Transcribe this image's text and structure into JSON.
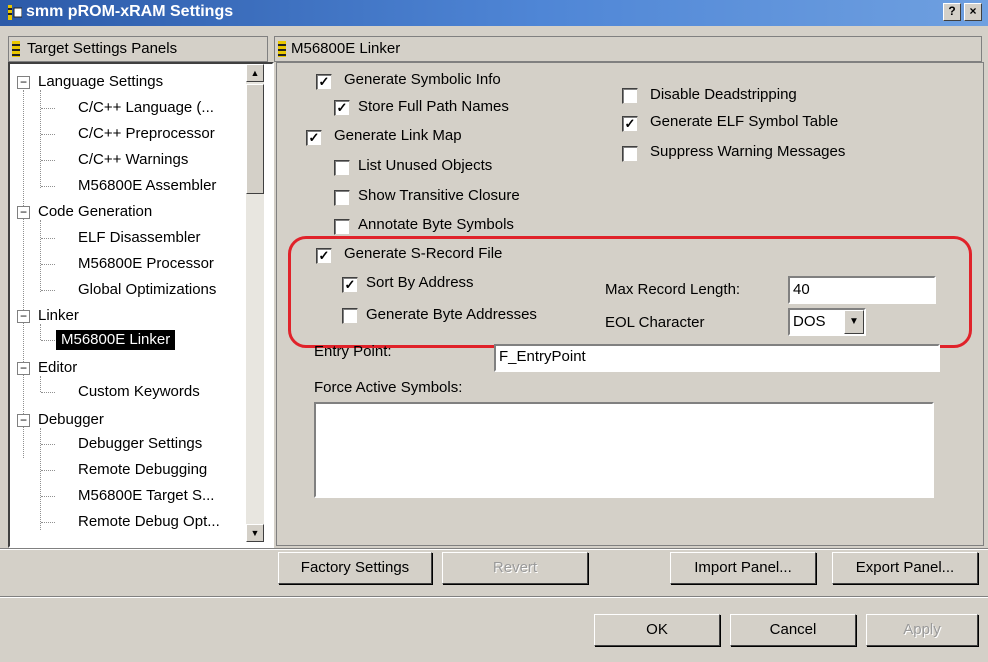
{
  "window": {
    "title": "smm pROM-xRAM Settings",
    "help_glyph": "?",
    "close_glyph": "×"
  },
  "left_panel": {
    "header": "Target Settings Panels",
    "tree": [
      {
        "label": "Language Settings",
        "level": 0,
        "expanded": true
      },
      {
        "label": "C/C++ Language (...",
        "level": 1
      },
      {
        "label": "C/C++ Preprocessor",
        "level": 1
      },
      {
        "label": "C/C++ Warnings",
        "level": 1
      },
      {
        "label": "M56800E Assembler",
        "level": 1
      },
      {
        "label": "Code Generation",
        "level": 0,
        "expanded": true
      },
      {
        "label": "ELF Disassembler",
        "level": 1
      },
      {
        "label": "M56800E Processor",
        "level": 1
      },
      {
        "label": "Global Optimizations",
        "level": 1
      },
      {
        "label": "Linker",
        "level": 0,
        "expanded": true
      },
      {
        "label": "M56800E Linker",
        "level": 1,
        "selected": true
      },
      {
        "label": "Editor",
        "level": 0,
        "expanded": true
      },
      {
        "label": "Custom Keywords",
        "level": 1
      },
      {
        "label": "Debugger",
        "level": 0,
        "expanded": true
      },
      {
        "label": "Debugger Settings",
        "level": 1
      },
      {
        "label": "Remote Debugging",
        "level": 1
      },
      {
        "label": "M56800E Target S...",
        "level": 1
      },
      {
        "label": "Remote Debug Opt...",
        "level": 1
      }
    ]
  },
  "right_panel": {
    "header": "M56800E Linker",
    "options": {
      "generate_symbolic_info": {
        "label": "Generate Symbolic Info",
        "checked": true
      },
      "store_full_path_names": {
        "label": "Store Full Path Names",
        "checked": true
      },
      "generate_link_map": {
        "label": "Generate Link Map",
        "checked": true
      },
      "list_unused_objects": {
        "label": "List Unused Objects",
        "checked": false
      },
      "show_transitive_closure": {
        "label": "Show Transitive Closure",
        "checked": false
      },
      "annotate_byte_symbols": {
        "label": "Annotate Byte Symbols",
        "checked": false
      },
      "disable_deadstripping": {
        "label": "Disable Deadstripping",
        "checked": false
      },
      "generate_elf_symbol_table": {
        "label": "Generate ELF Symbol Table",
        "checked": true
      },
      "suppress_warning_messages": {
        "label": "Suppress Warning Messages",
        "checked": false
      },
      "generate_s_record_file": {
        "label": "Generate S-Record File",
        "checked": true
      },
      "sort_by_address": {
        "label": "Sort By Address",
        "checked": true
      },
      "generate_byte_addresses": {
        "label": "Generate Byte Addresses",
        "checked": false
      }
    },
    "max_record_length": {
      "label": "Max Record Length:",
      "value": "40"
    },
    "eol_character": {
      "label": "EOL Character",
      "value": "DOS"
    },
    "entry_point": {
      "label": "Entry Point:",
      "value": "F_EntryPoint"
    },
    "force_active_symbols": {
      "label": "Force Active Symbols:",
      "value": ""
    },
    "check_glyph": "✓",
    "highlight_color": "#e0222a"
  },
  "buttons": {
    "factory_settings": "Factory Settings",
    "revert": "Revert",
    "import_panel": "Import Panel...",
    "export_panel": "Export Panel...",
    "ok": "OK",
    "cancel": "Cancel",
    "apply": "Apply"
  }
}
